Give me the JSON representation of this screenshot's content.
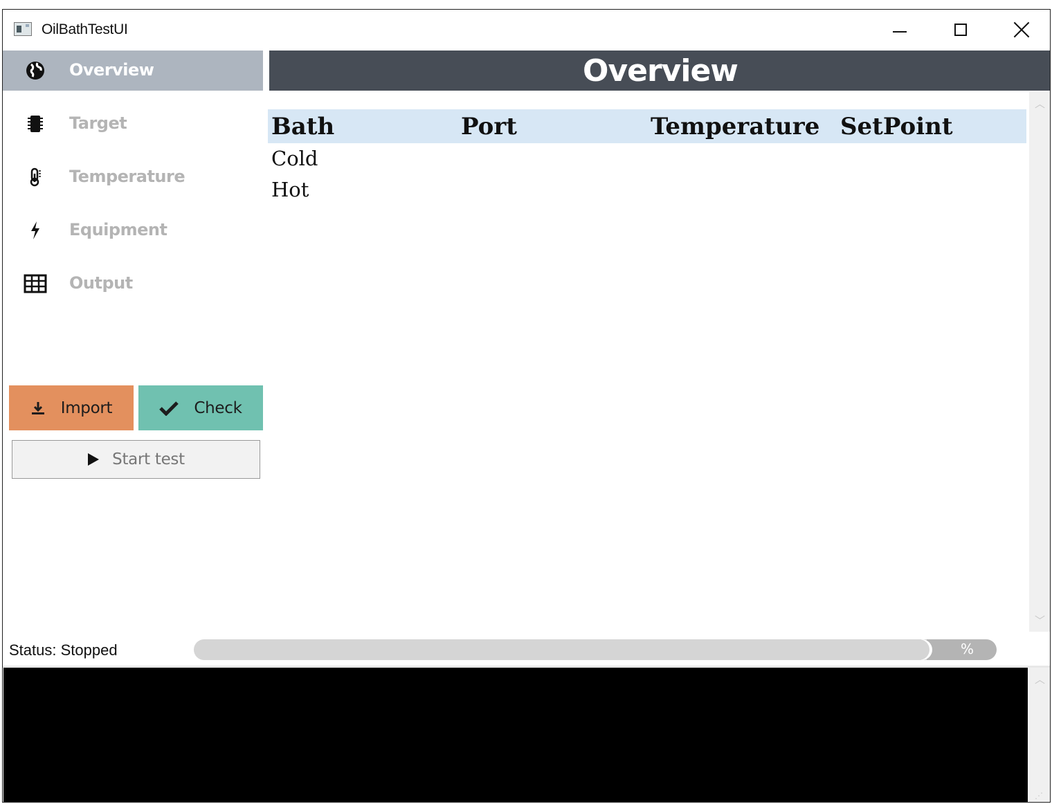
{
  "window": {
    "title": "OilBathTestUI"
  },
  "sidebar": {
    "items": [
      {
        "label": "Overview",
        "icon": "globe-icon",
        "active": true
      },
      {
        "label": "Target",
        "icon": "chip-icon",
        "active": false
      },
      {
        "label": "Temperature",
        "icon": "thermometer-icon",
        "active": false
      },
      {
        "label": "Equipment",
        "icon": "bolt-icon",
        "active": false
      },
      {
        "label": "Output",
        "icon": "grid-table-icon",
        "active": false
      }
    ],
    "import_label": "Import",
    "check_label": "Check",
    "start_label": "Start test"
  },
  "header": {
    "title": "Overview"
  },
  "table": {
    "columns": [
      "Bath",
      "Port",
      "Temperature",
      "SetPoint"
    ],
    "rows": [
      [
        "Cold",
        "",
        "",
        ""
      ],
      [
        "Hot",
        "",
        "",
        ""
      ]
    ]
  },
  "status": {
    "text": "Status: Stopped",
    "progress_label": "%"
  },
  "colors": {
    "header_bg": "#474d56",
    "active_nav_bg": "#adb5bf",
    "import_bg": "#e3905e",
    "check_bg": "#70c1b0",
    "table_header_bg": "#d7e7f5",
    "console_bg": "#000000"
  }
}
